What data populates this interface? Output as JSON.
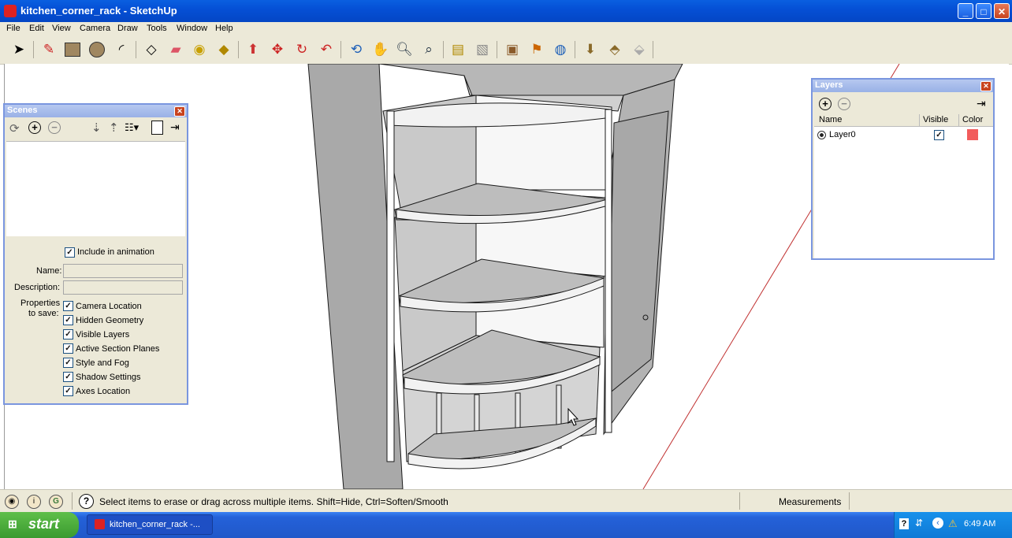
{
  "window": {
    "title": "kitchen_corner_rack - SketchUp",
    "min": "_",
    "max": "□",
    "close": "✕"
  },
  "menu": [
    "File",
    "Edit",
    "View",
    "Camera",
    "Draw",
    "Tools",
    "Window",
    "Help"
  ],
  "toolbar": {
    "icons": [
      "select-icon",
      "pencil-icon",
      "rectangle-icon",
      "circle-icon",
      "arc-icon",
      "make-component-icon",
      "eraser-icon",
      "tape-measure-icon",
      "paint-bucket-icon",
      "push-pull-icon",
      "move-icon",
      "rotate-icon",
      "offset-icon",
      "orbit-icon",
      "pan-icon",
      "zoom-icon",
      "zoom-extents-icon",
      "get-models-icon",
      "share-model-icon",
      "components-icon",
      "3d-warehouse-icon",
      "google-earth-icon",
      "get-current-view-icon",
      "toggle-terrain-icon",
      "place-model-icon"
    ]
  },
  "scenes": {
    "title": "Scenes",
    "include_label": "Include in animation",
    "name_label": "Name:",
    "name_value": "",
    "description_label": "Description:",
    "description_value": "",
    "properties_label_1": "Properties",
    "properties_label_2": "to save:",
    "properties": [
      "Camera Location",
      "Hidden Geometry",
      "Visible Layers",
      "Active Section Planes",
      "Style and Fog",
      "Shadow Settings",
      "Axes Location"
    ]
  },
  "layers": {
    "title": "Layers",
    "columns": [
      "Name",
      "Visible",
      "Color"
    ],
    "rows": [
      {
        "name": "Layer0",
        "visible": true,
        "color": "#f25c5c"
      }
    ]
  },
  "status": {
    "message": "Select items to erase or drag across multiple items. Shift=Hide, Ctrl=Soften/Smooth",
    "measurements_label": "Measurements",
    "measurements_value": ""
  },
  "taskbar": {
    "start": "start",
    "task": "kitchen_corner_rack -...",
    "clock": "6:49 AM"
  },
  "colors": {
    "face_gray": "#c9c9c9",
    "face_dark": "#a8a8a8",
    "face_light": "#f2f2f2",
    "edge": "#1a1a1a",
    "layer0": "#f25c5c"
  }
}
